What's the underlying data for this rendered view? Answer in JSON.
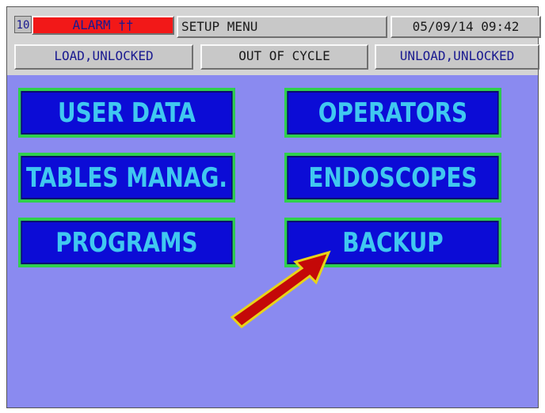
{
  "header": {
    "alarm_id": "10",
    "alarm_label": "ALARM ††",
    "title": "SETUP MENU",
    "datetime": "05/09/14  09:42"
  },
  "status": {
    "load": "LOAD,UNLOCKED",
    "cycle": "OUT OF CYCLE",
    "unload": "UNLOAD,UNLOCKED"
  },
  "menu": {
    "user_data": "USER DATA",
    "operators": "OPERATORS",
    "tables": "TABLES MANAG.",
    "endoscopes": "ENDOSCOPES",
    "programs": "PROGRAMS",
    "backup": "BACKUP"
  },
  "colors": {
    "background": "#8a8af0",
    "button_fill": "#0c0cd6",
    "button_border": "#2fd04c",
    "button_text": "#40c8f0",
    "alarm": "#f21818",
    "arrow_fill": "#c40808",
    "arrow_outline": "#e8d418"
  }
}
